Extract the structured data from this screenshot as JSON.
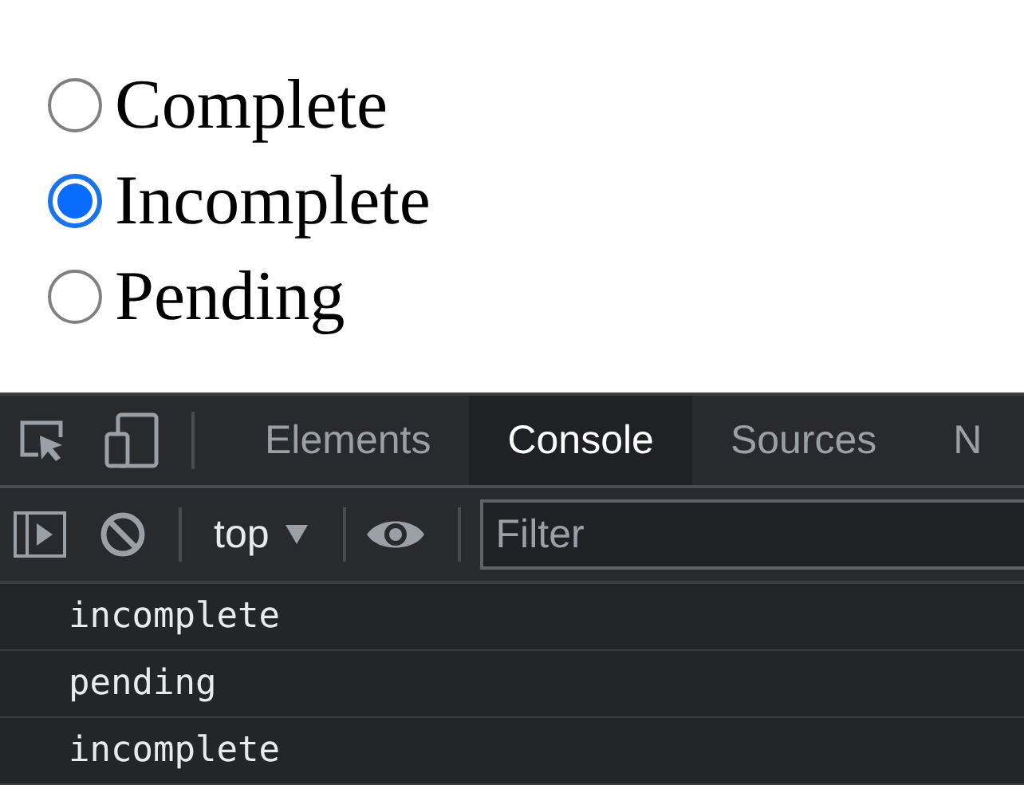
{
  "radios": [
    {
      "label": "Complete",
      "selected": false
    },
    {
      "label": "Incomplete",
      "selected": true
    },
    {
      "label": "Pending",
      "selected": false
    }
  ],
  "devtools": {
    "tabs": [
      {
        "label": "Elements",
        "selected": false
      },
      {
        "label": "Console",
        "selected": true
      },
      {
        "label": "Sources",
        "selected": false
      },
      {
        "label": "N",
        "selected": false
      }
    ],
    "context": "top",
    "filter": {
      "placeholder": "Filter"
    },
    "messages": [
      "incomplete",
      "pending",
      "incomplete"
    ]
  }
}
